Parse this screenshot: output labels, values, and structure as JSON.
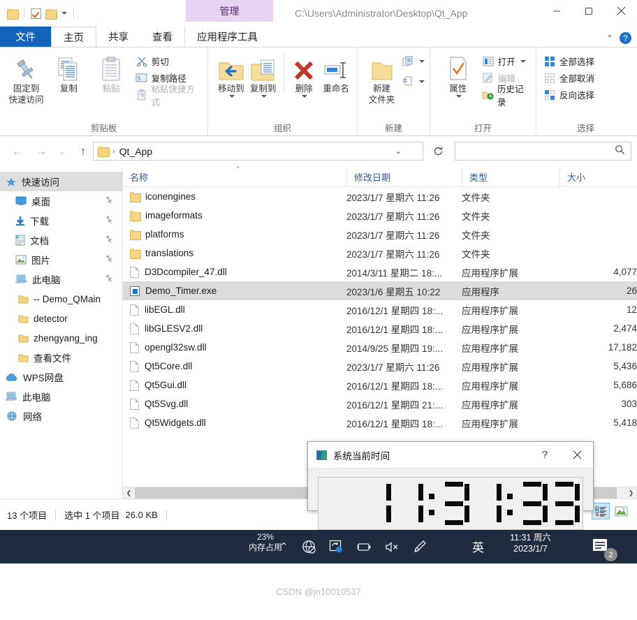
{
  "window": {
    "path_title": "C:\\Users\\Administrator\\Desktop\\Qt_App",
    "management_tab": "管理",
    "minimize": "—",
    "maximize": "□",
    "close": "✕"
  },
  "tabs": [
    {
      "label": "文件",
      "kind": "file"
    },
    {
      "label": "主页",
      "kind": "active"
    },
    {
      "label": "共享",
      "kind": "normal"
    },
    {
      "label": "查看",
      "kind": "normal"
    },
    {
      "label": "应用程序工具",
      "kind": "apptools"
    }
  ],
  "ribbon": {
    "help_label": "?",
    "collapse_label": "⌃",
    "groups": [
      {
        "name": "剪贴板",
        "big": [
          {
            "label1": "固定到",
            "label2": "快速访问",
            "icon": "pin-icon",
            "dim": false
          },
          {
            "label1": "复制",
            "label2": "",
            "icon": "copy-icon",
            "dim": false
          },
          {
            "label1": "粘贴",
            "label2": "",
            "icon": "paste-icon",
            "dim": true
          }
        ],
        "small": [
          {
            "label": "剪切",
            "icon": "scissors-icon",
            "dim": false
          },
          {
            "label": "复制路径",
            "icon": "copy-path-icon",
            "dim": false
          },
          {
            "label": "粘贴快捷方式",
            "icon": "paste-shortcut-icon",
            "dim": true
          }
        ]
      },
      {
        "name": "组织",
        "big": [
          {
            "label1": "移动到",
            "label2": "",
            "icon": "move-to-icon",
            "dim": false
          },
          {
            "label1": "复制到",
            "label2": "",
            "icon": "copy-to-icon",
            "dim": false
          },
          {
            "label1": "删除",
            "label2": "",
            "icon": "delete-icon",
            "dim": false
          },
          {
            "label1": "重命名",
            "label2": "",
            "icon": "rename-icon",
            "dim": false
          }
        ],
        "small": []
      },
      {
        "name": "新建",
        "big": [
          {
            "label1": "新建",
            "label2": "文件夹",
            "icon": "new-folder-icon",
            "dim": false
          }
        ],
        "small": [
          {
            "label": "",
            "icon": "new-item-icon",
            "dim": false
          },
          {
            "label": "",
            "icon": "easy-access-icon",
            "dim": false
          }
        ]
      },
      {
        "name": "打开",
        "big": [
          {
            "label1": "属性",
            "label2": "",
            "icon": "properties-icon",
            "dim": false
          }
        ],
        "small": [
          {
            "label": "打开",
            "icon": "open-icon",
            "dim": false
          },
          {
            "label": "编辑",
            "icon": "edit-icon",
            "dim": true
          },
          {
            "label": "历史记录",
            "icon": "history-icon",
            "dim": false
          }
        ]
      },
      {
        "name": "选择",
        "big": [],
        "small": [
          {
            "label": "全部选择",
            "icon": "select-all-icon",
            "dim": false
          },
          {
            "label": "全部取消",
            "icon": "select-none-icon",
            "dim": false
          },
          {
            "label": "反向选择",
            "icon": "invert-selection-icon",
            "dim": false
          }
        ]
      }
    ]
  },
  "address": {
    "back": "←",
    "forward": "→",
    "recent": "⌄",
    "up": "↑",
    "crumb": "Qt_App",
    "crumb_sep": "›",
    "dropdown": "⌄",
    "refresh": "↻",
    "search_placeholder": "",
    "search_icon": "search-icon"
  },
  "sidebar": {
    "items": [
      {
        "label": "快速访问",
        "icon": "quick-access-icon",
        "selected": true,
        "pinned": false,
        "indent": 0
      },
      {
        "label": "桌面",
        "icon": "desktop-icon",
        "selected": false,
        "pinned": true,
        "indent": 1
      },
      {
        "label": "下载",
        "icon": "downloads-icon",
        "selected": false,
        "pinned": true,
        "indent": 1
      },
      {
        "label": "文档",
        "icon": "documents-icon",
        "selected": false,
        "pinned": true,
        "indent": 1
      },
      {
        "label": "图片",
        "icon": "pictures-icon",
        "selected": false,
        "pinned": true,
        "indent": 1
      },
      {
        "label": "此电脑",
        "icon": "this-pc-icon",
        "selected": false,
        "pinned": true,
        "indent": 1
      },
      {
        "label": "-- Demo_QMain",
        "icon": "folder-icon",
        "selected": false,
        "pinned": false,
        "indent": 2
      },
      {
        "label": "detector",
        "icon": "folder-icon",
        "selected": false,
        "pinned": false,
        "indent": 2
      },
      {
        "label": "zhengyang_ing",
        "icon": "folder-icon",
        "selected": false,
        "pinned": false,
        "indent": 2
      },
      {
        "label": "查看文件",
        "icon": "folder-icon",
        "selected": false,
        "pinned": false,
        "indent": 2
      },
      {
        "label": "WPS网盘",
        "icon": "cloud-icon",
        "selected": false,
        "pinned": false,
        "indent": 0
      },
      {
        "label": "此电脑",
        "icon": "this-pc-icon",
        "selected": false,
        "pinned": false,
        "indent": 0
      },
      {
        "label": "网络",
        "icon": "network-icon",
        "selected": false,
        "pinned": false,
        "indent": 0
      }
    ]
  },
  "filelist": {
    "columns": [
      "名称",
      "修改日期",
      "类型",
      "大小"
    ],
    "sort_indicator": "⌃",
    "rows": [
      {
        "name": "iconengines",
        "date": "2023/1/7 星期六 11:26",
        "type": "文件夹",
        "size": "",
        "icon": "folder-icon",
        "selected": false
      },
      {
        "name": "imageformats",
        "date": "2023/1/7 星期六 11:26",
        "type": "文件夹",
        "size": "",
        "icon": "folder-icon",
        "selected": false
      },
      {
        "name": "platforms",
        "date": "2023/1/7 星期六 11:26",
        "type": "文件夹",
        "size": "",
        "icon": "folder-icon",
        "selected": false
      },
      {
        "name": "translations",
        "date": "2023/1/7 星期六 11:26",
        "type": "文件夹",
        "size": "",
        "icon": "folder-icon",
        "selected": false
      },
      {
        "name": "D3Dcompiler_47.dll",
        "date": "2014/3/11 星期二 18:...",
        "type": "应用程序扩展",
        "size": "4,077",
        "icon": "dll-icon",
        "selected": false
      },
      {
        "name": "Demo_Timer.exe",
        "date": "2023/1/6 星期五 10:22",
        "type": "应用程序",
        "size": "26",
        "icon": "exe-icon",
        "selected": true
      },
      {
        "name": "libEGL.dll",
        "date": "2016/12/1 星期四 18:...",
        "type": "应用程序扩展",
        "size": "12",
        "icon": "dll-icon",
        "selected": false
      },
      {
        "name": "libGLESV2.dll",
        "date": "2016/12/1 星期四 18:...",
        "type": "应用程序扩展",
        "size": "2,474",
        "icon": "dll-icon",
        "selected": false
      },
      {
        "name": "opengl32sw.dll",
        "date": "2014/9/25 星期四 19:...",
        "type": "应用程序扩展",
        "size": "17,182",
        "icon": "dll-icon",
        "selected": false
      },
      {
        "name": "Qt5Core.dll",
        "date": "2023/1/7 星期六 11:26",
        "type": "应用程序扩展",
        "size": "5,436",
        "icon": "dll-icon",
        "selected": false
      },
      {
        "name": "Qt5Gui.dll",
        "date": "2016/12/1 星期四 18:...",
        "type": "应用程序扩展",
        "size": "5,686",
        "icon": "dll-icon",
        "selected": false
      },
      {
        "name": "Qt5Svg.dll",
        "date": "2016/12/1 星期四 21:...",
        "type": "应用程序扩展",
        "size": "303",
        "icon": "dll-icon",
        "selected": false
      },
      {
        "name": "Qt5Widgets.dll",
        "date": "2016/12/1 星期四 18:...",
        "type": "应用程序扩展",
        "size": "5,418",
        "icon": "dll-icon",
        "selected": false
      }
    ]
  },
  "statusbar": {
    "item_count": "13 个项目",
    "selection": "选中 1 个项目",
    "selection_size": "26.0 KB",
    "view_details_icon": "details-view-icon",
    "view_thumbnails_icon": "thumbnails-view-icon"
  },
  "dialog": {
    "title": "系统当前时间",
    "help_label": "?",
    "close_label": "✕",
    "time": "11:31:33",
    "icon": "app-icon"
  },
  "taskbar": {
    "perf_percent": "23%",
    "perf_label": "内存占用",
    "chevron": "⌃",
    "icons": [
      "network-offline-icon",
      "onedrive-sync-icon",
      "battery-icon",
      "volume-mute-icon",
      "pen-icon"
    ],
    "ime": "英",
    "clock_time": "11:31 周六",
    "clock_date": "2023/1/7",
    "notification_count": "2",
    "notification_icon": "action-center-icon"
  },
  "watermark": {
    "text": "CSDN @jn10010537"
  }
}
